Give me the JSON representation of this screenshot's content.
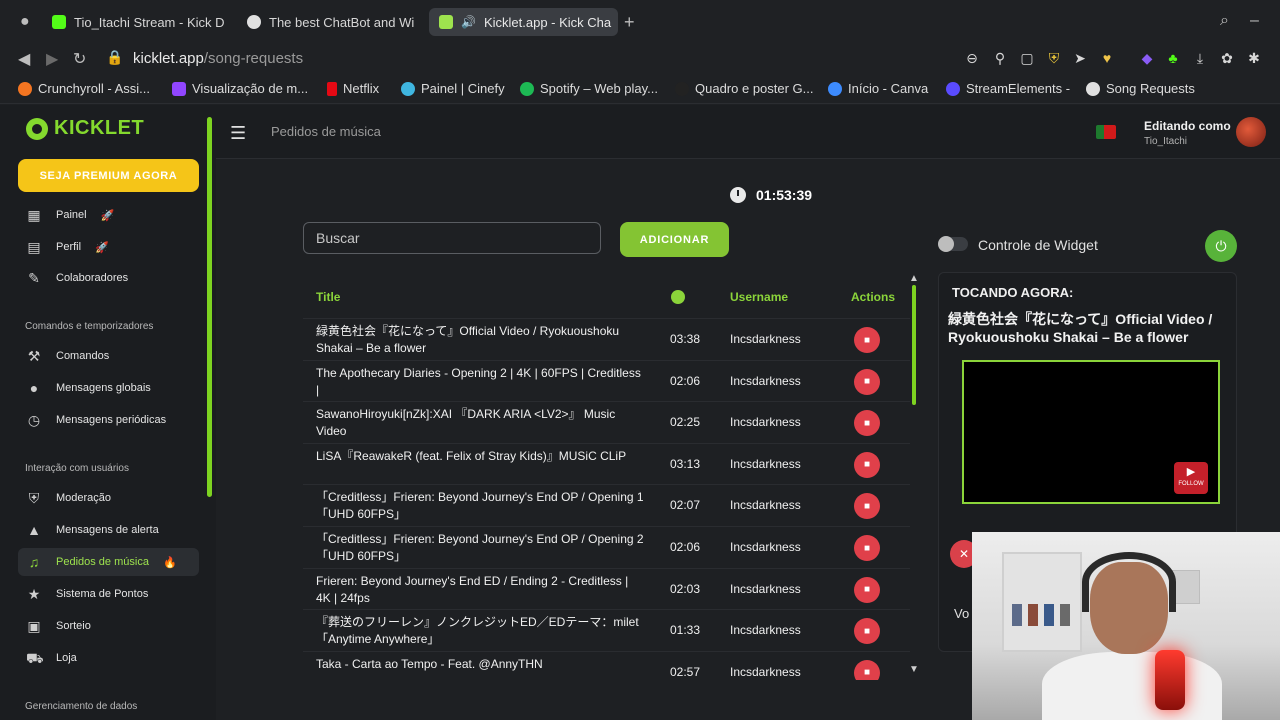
{
  "browser": {
    "tabs": [
      {
        "label": "Tio_Itachi Stream - Kick D",
        "color": "#53fc18"
      },
      {
        "label": "The best ChatBot and Wi",
        "color": "#e0e0e0"
      },
      {
        "label": "Kicklet.app - Kick Cha",
        "color": "#9ee34e"
      }
    ],
    "new_tab": "+",
    "url_host": "kicklet.app",
    "url_path": "/song-requests",
    "bookmarks": [
      {
        "label": "Crunchyroll - Assi...",
        "color": "#f47521"
      },
      {
        "label": "Visualização de m...",
        "color": "#9146ff"
      },
      {
        "label": "Netflix",
        "color": "#e50914"
      },
      {
        "label": "Painel | Cinefy",
        "color": "#3fb6e0"
      },
      {
        "label": "Spotify – Web play...",
        "color": "#1db954"
      },
      {
        "label": "Quadro e poster G...",
        "color": "#222222"
      },
      {
        "label": "Início - Canva",
        "color": "#3d8bfd"
      },
      {
        "label": "StreamElements -",
        "color": "#5a4bff"
      },
      {
        "label": "Song Requests",
        "color": "#e0e0e0"
      }
    ]
  },
  "sidebar": {
    "logo": "KICKLET",
    "premium": "SEJA PREMIUM AGORA",
    "items_top": [
      {
        "label": "Painel",
        "badge": "🚀",
        "icon": "grid-icon"
      },
      {
        "label": "Perfil",
        "badge": "🚀",
        "icon": "clipboard-icon"
      },
      {
        "label": "Colaboradores",
        "icon": "wrench-icon"
      }
    ],
    "section1": "Comandos e temporizadores",
    "items_cmd": [
      {
        "label": "Comandos",
        "icon": "hammer-icon"
      },
      {
        "label": "Mensagens globais",
        "icon": "chat-icon"
      },
      {
        "label": "Mensagens periódicas",
        "icon": "clock-icon"
      }
    ],
    "section2": "Interação com usuários",
    "items_int": [
      {
        "label": "Moderação",
        "icon": "shield-icon"
      },
      {
        "label": "Mensagens de alerta",
        "icon": "warning-icon"
      },
      {
        "label": "Pedidos de música",
        "badge": "🔥",
        "icon": "music-icon"
      },
      {
        "label": "Sistema de Pontos",
        "icon": "star-icon"
      },
      {
        "label": "Sorteio",
        "icon": "gift-icon"
      },
      {
        "label": "Loja",
        "icon": "cart-icon"
      }
    ],
    "section3": "Gerenciamento de dados"
  },
  "header": {
    "title": "Pedidos de música",
    "editing_as": "Editando como",
    "user": "Tio_Itachi"
  },
  "main": {
    "timer": "01:53:39",
    "search_placeholder": "Buscar",
    "add_label": "ADICIONAR",
    "columns": {
      "title": "Title",
      "username": "Username",
      "actions": "Actions"
    },
    "rows": [
      {
        "title": "緑黄色社会『花になって』Official Video / Ryokuoushoku Shakai – Be a flower",
        "duration": "03:38",
        "user": "Incsdarkness"
      },
      {
        "title": "The Apothecary Diaries - Opening 2 | 4K | 60FPS | Creditless |",
        "duration": "02:06",
        "user": "Incsdarkness"
      },
      {
        "title": "SawanoHiroyuki[nZk]:XAI 『DARK ARIA <LV2>』 Music Video",
        "duration": "02:25",
        "user": "Incsdarkness"
      },
      {
        "title": "LiSA『ReawakeR (feat. Felix of Stray Kids)』MUSiC CLiP",
        "duration": "03:13",
        "user": "Incsdarkness"
      },
      {
        "title": "「Creditless」Frieren: Beyond Journey's End OP / Opening 1「UHD 60FPS」",
        "duration": "02:07",
        "user": "Incsdarkness"
      },
      {
        "title": "「Creditless」Frieren: Beyond Journey's End OP / Opening 2「UHD 60FPS」",
        "duration": "02:06",
        "user": "Incsdarkness"
      },
      {
        "title": "Frieren: Beyond Journey's End ED / Ending 2 - Creditless | 4K | 24fps",
        "duration": "02:03",
        "user": "Incsdarkness"
      },
      {
        "title": "『葬送のフリーレン』ノンクレジットED／EDテーマ：milet「Anytime Anywhere」",
        "duration": "01:33",
        "user": "Incsdarkness"
      },
      {
        "title": "Taka - Carta ao Tempo - Feat. @AnnyTHN",
        "duration": "02:57",
        "user": "Incsdarkness"
      }
    ],
    "widget_label": "Controle de Widget",
    "now_playing_label": "TOCANDO AGORA:",
    "now_playing_title": "緑黄色社会『花になって』Official Video / Ryokuoushoku Shakai – Be a flower",
    "yt_follow": "FOLLOW",
    "volume_label": "Vo"
  }
}
